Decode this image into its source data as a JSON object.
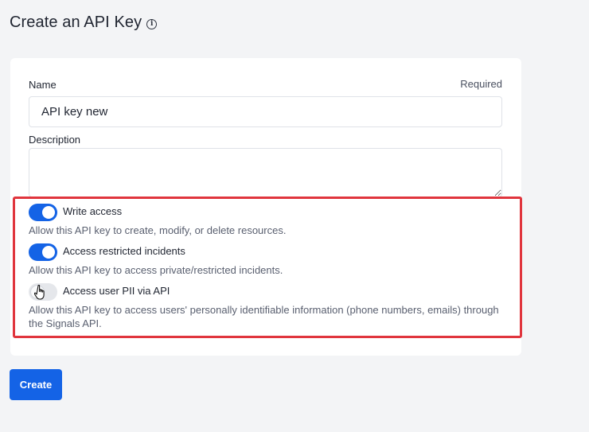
{
  "page": {
    "title": "Create an API Key",
    "info_icon": "info-circle-icon"
  },
  "form": {
    "name_label": "Name",
    "required_label": "Required",
    "name_value": "API key new",
    "description_label": "Description",
    "description_value": ""
  },
  "permissions": [
    {
      "title": "Write access",
      "description": "Allow this API key to create, modify, or delete resources.",
      "enabled": true
    },
    {
      "title": "Access restricted incidents",
      "description": "Allow this API key to access private/restricted incidents.",
      "enabled": true
    },
    {
      "title": "Access user PII via API",
      "description": "Allow this API key to access users' personally identifiable information (phone numbers, emails) through the Signals API.",
      "enabled": false
    }
  ],
  "actions": {
    "create_label": "Create"
  },
  "colors": {
    "accent": "#1463e6",
    "highlight": "#e0353d",
    "background": "#f3f4f6"
  }
}
